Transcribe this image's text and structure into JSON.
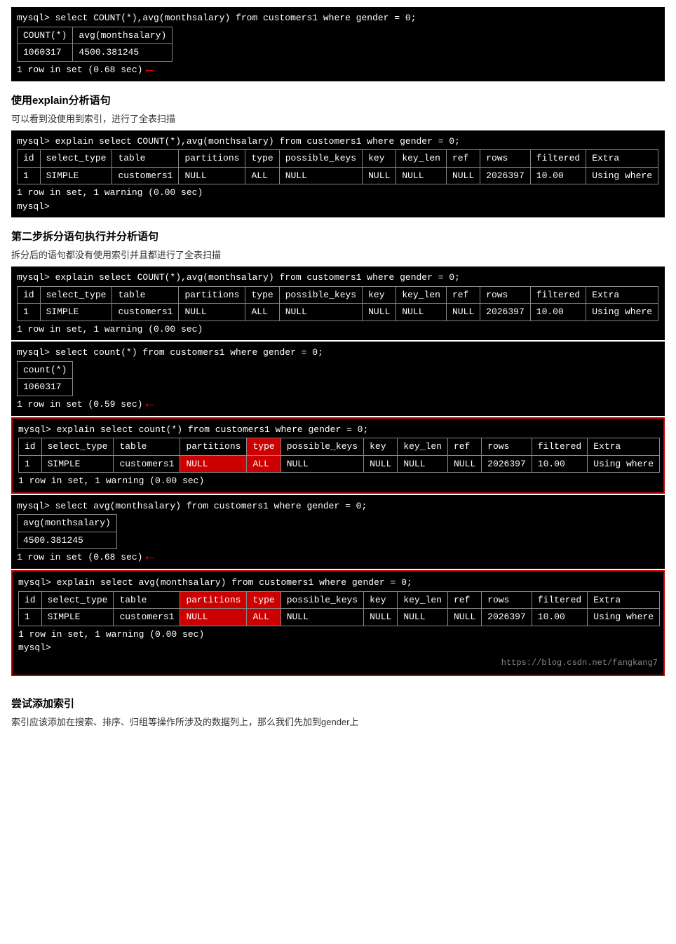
{
  "section1": {
    "query": "mysql> select COUNT(*),avg(monthsalary) from customers1 where gender = 0;",
    "table_headers": [
      "COUNT(*)",
      "avg(monthsalary)"
    ],
    "table_rows": [
      [
        "1060317",
        "4500.381245"
      ]
    ],
    "footer": "1 row in set (0.68 sec)"
  },
  "section2": {
    "heading": "使用explain分析语句",
    "desc": "可以看到没使用到索引，进行了全表扫描",
    "query": "mysql> explain select COUNT(*),avg(monthsalary) from customers1 where gender = 0;",
    "table_headers": [
      "id",
      "select_type",
      "table",
      "partitions",
      "type",
      "possible_keys",
      "key",
      "key_len",
      "ref",
      "rows",
      "filtered",
      "Extra"
    ],
    "table_rows": [
      [
        "1",
        "SIMPLE",
        "customers1",
        "NULL",
        "ALL",
        "NULL",
        "NULL",
        "NULL",
        "NULL",
        "2026397",
        "10.00",
        "Using where"
      ]
    ],
    "footer1": "1 row in set, 1 warning (0.00 sec)",
    "footer2": "mysql>"
  },
  "section3": {
    "heading": "第二步拆分语句执行并分析语句",
    "desc": "拆分后的语句都没有使用索引并且都进行了全表扫描"
  },
  "block1": {
    "query": "mysql> explain select COUNT(*),avg(monthsalary) from customers1 where gender = 0;",
    "table_headers": [
      "id",
      "select_type",
      "table",
      "partitions",
      "type",
      "possible_keys",
      "key",
      "key_len",
      "ref",
      "rows",
      "filtered",
      "Extra"
    ],
    "table_rows": [
      [
        "1",
        "SIMPLE",
        "customers1",
        "NULL",
        "ALL",
        "NULL",
        "NULL",
        "NULL",
        "NULL",
        "2026397",
        "10.00",
        "Using where"
      ]
    ],
    "footer": "1 row in set, 1 warning (0.00 sec)"
  },
  "block2": {
    "query": "mysql> select count(*) from customers1 where gender = 0;",
    "count_header": "count(*)",
    "count_val": "1060317",
    "footer": "1 row in set (0.59 sec)"
  },
  "block3": {
    "query": "mysql> explain select count(*) from customers1 where gender = 0;",
    "table_headers": [
      "id",
      "select_type",
      "table",
      "partitions",
      "type",
      "possible_keys",
      "key",
      "key_len",
      "ref",
      "rows",
      "filtered",
      "Extra"
    ],
    "table_rows": [
      [
        "1",
        "SIMPLE",
        "customers1",
        "NULL",
        "ALL",
        "NULL",
        "NULL",
        "NULL",
        "NULL",
        "2026397",
        "10.00",
        "Using where"
      ]
    ],
    "footer": "1 row in set, 1 warning (0.00 sec)"
  },
  "block4": {
    "query": "mysql> select avg(monthsalary) from customers1 where gender = 0;",
    "avg_header": "avg(monthsalary)",
    "avg_val": "4500.381245",
    "footer": "1 row in set (0.68 sec)"
  },
  "block5": {
    "query": "mysql> explain select avg(monthsalary) from customers1 where gender = 0;",
    "table_headers": [
      "id",
      "select_type",
      "table",
      "partitions",
      "type",
      "possible_keys",
      "key",
      "key_len",
      "ref",
      "rows",
      "filtered",
      "Extra"
    ],
    "table_rows": [
      [
        "1",
        "SIMPLE",
        "customers1",
        "NULL",
        "ALL",
        "NULL",
        "NULL",
        "NULL",
        "NULL",
        "2026397",
        "10.00",
        "Using where"
      ]
    ],
    "footer1": "1 row in set, 1 warning (0.00 sec)",
    "footer2": "mysql>",
    "url": "https://blog.csdn.net/fangkang7"
  },
  "section4": {
    "heading": "尝试添加索引",
    "desc": "索引应该添加在搜索、排序、归组等操作所涉及的数据列上，那么我们先加到gender上"
  }
}
